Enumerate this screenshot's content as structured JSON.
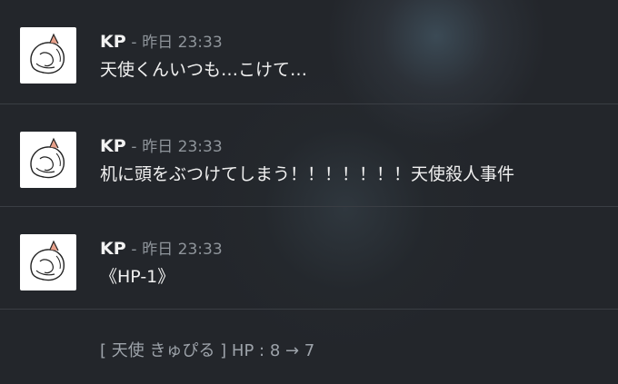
{
  "messages": [
    {
      "author": "KP",
      "separator": "-",
      "time": "昨日 23:33",
      "text": "天使くんいつも…こけて…"
    },
    {
      "author": "KP",
      "separator": "-",
      "time": "昨日 23:33",
      "text": "机に頭をぶつけてしまう！！！！！！！天使殺人事件"
    },
    {
      "author": "KP",
      "separator": "-",
      "time": "昨日 23:33",
      "text": "《HP-1》"
    }
  ],
  "system_message": "[ 天使 きゅぴる ] HP : 8 → 7",
  "avatar_icon": "cat-curled-icon"
}
